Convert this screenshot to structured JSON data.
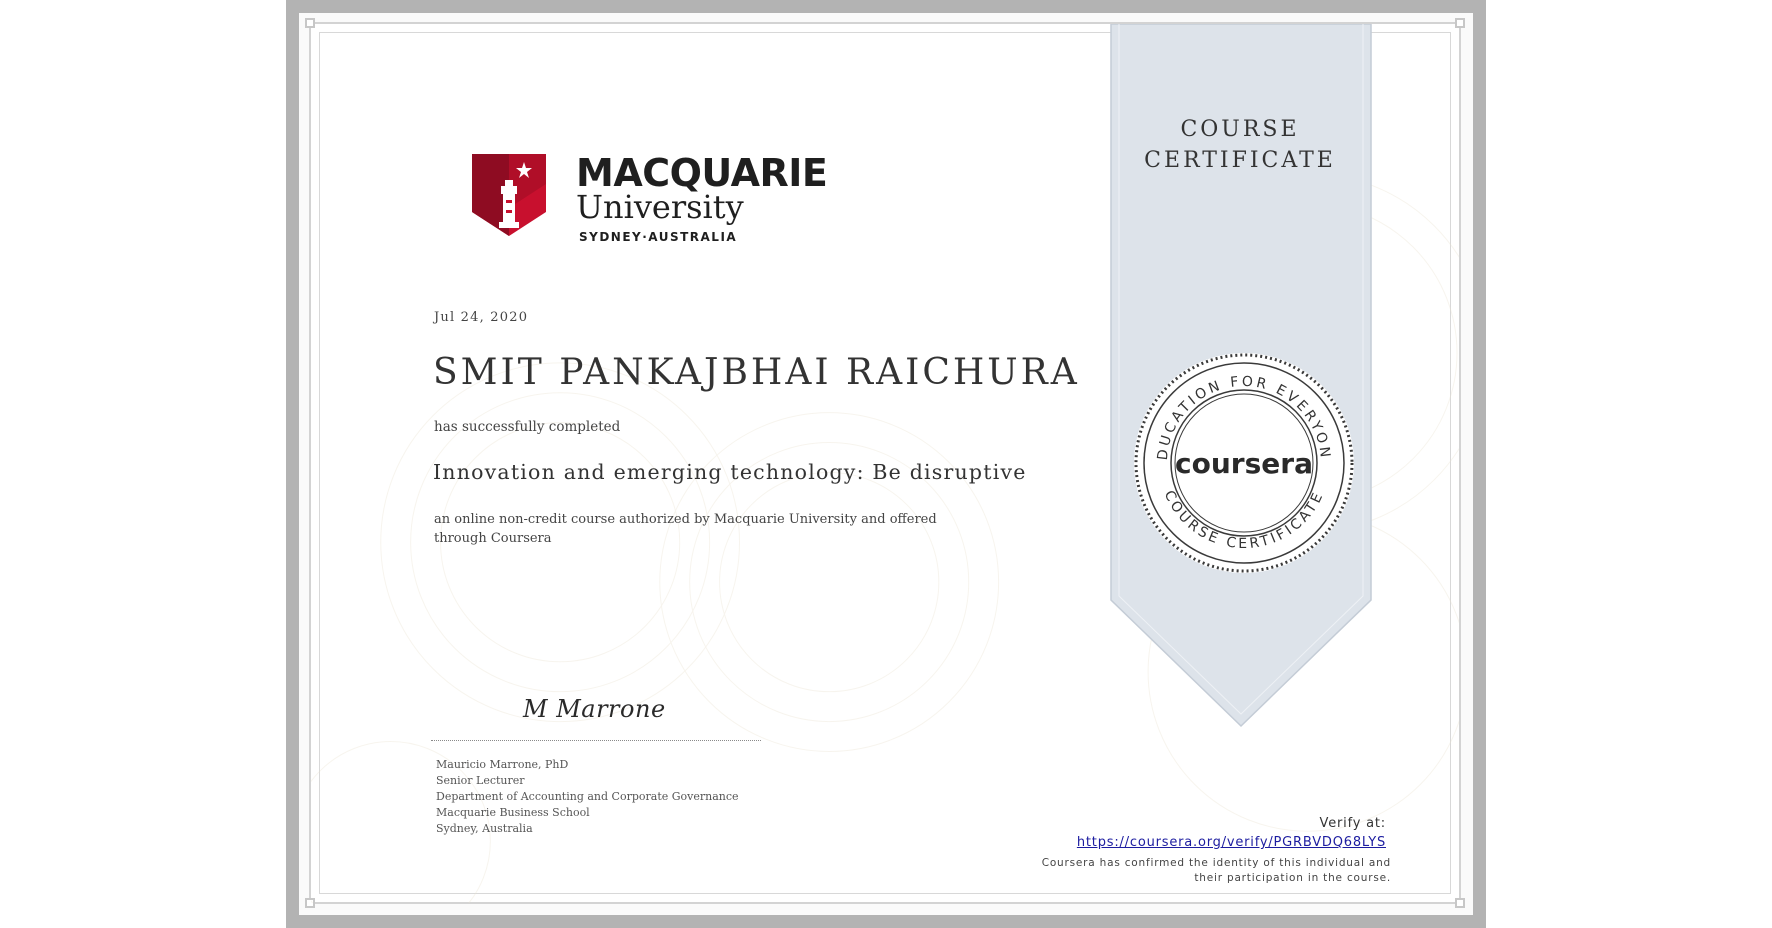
{
  "logo": {
    "name_line_1": "MACQUARIE",
    "name_line_2": "University",
    "location": "SYDNEY·AUSTRALIA",
    "brand_color": "#c8102e"
  },
  "certificate": {
    "date": "Jul 24, 2020",
    "recipient": "SMIT PANKAJBHAI RAICHURA",
    "completed_text": "has successfully completed",
    "course_title": "Innovation and emerging technology: Be disruptive",
    "description": "an online non-credit course authorized by Macquarie University and offered through Coursera"
  },
  "signature": {
    "handwritten": "M Marrone",
    "lines": [
      "Mauricio Marrone, PhD",
      "Senior Lecturer",
      "Department of Accounting and Corporate Governance",
      "Macquarie Business School",
      "Sydney, Australia"
    ]
  },
  "ribbon": {
    "title_line_1": "COURSE",
    "title_line_2": "CERTIFICATE",
    "ribbon_color": "#dde3ea"
  },
  "seal": {
    "top_arc": "EDUCATION FOR EVERYONE",
    "bottom_arc": "COURSE CERTIFICATE",
    "center": "coursera"
  },
  "verify": {
    "label": "Verify at:",
    "url": "https://coursera.org/verify/PGRBVDQ68LYS",
    "note_line_1": "Coursera has confirmed the identity of this individual and",
    "note_line_2": "their participation in the course."
  }
}
